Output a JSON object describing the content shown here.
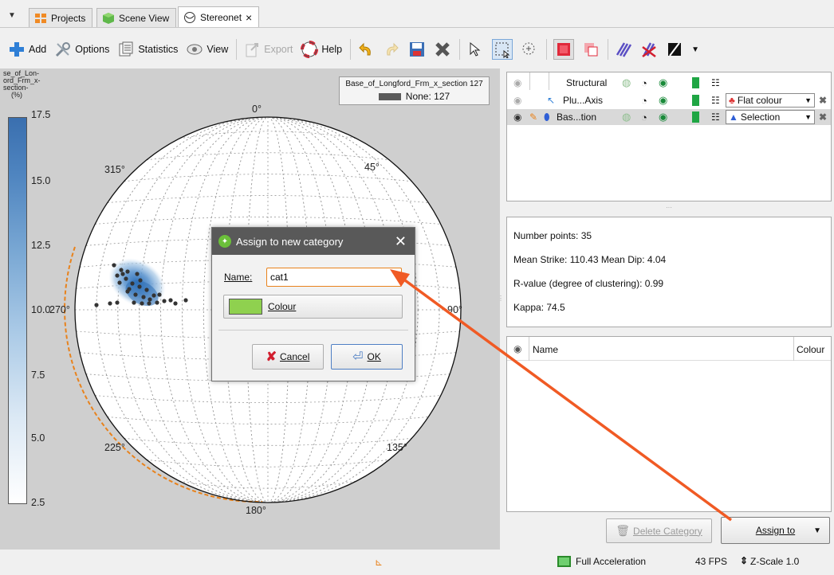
{
  "tabs": {
    "projects": "Projects",
    "scene_view": "Scene View",
    "stereonet": "Stereonet",
    "close_glyph": "×"
  },
  "toolbar": {
    "add": "Add",
    "options": "Options",
    "statistics": "Statistics",
    "view": "View",
    "export": "Export",
    "help": "Help"
  },
  "colorbar": {
    "title_lines": [
      "se_of_Lon-",
      "ord_Frm_x-",
      "section-",
      "(%)"
    ],
    "ticks": [
      "17.5",
      "15.0",
      "12.5",
      "10.0",
      "7.5",
      "5.0",
      "2.5"
    ]
  },
  "stereonet": {
    "labels": {
      "n": "0°",
      "ne": "45°",
      "e": "90°",
      "se": "135°",
      "s": "180°",
      "sw": "225°",
      "w": "270°",
      "nw": "315°"
    }
  },
  "legend": {
    "title": "Base_of_Longford_Frm_x_section 127",
    "entry": "None: 127",
    "swatch_color": "#5a5a5a"
  },
  "layers": {
    "header_label": "Structural",
    "rows": [
      {
        "name": "Plu...Axis",
        "mode": "Flat colour"
      },
      {
        "name": "Bas...tion",
        "mode": "Selection"
      }
    ]
  },
  "stats": {
    "number_points": "Number points: 35",
    "mean_strike_dip": "Mean Strike: 110.43  Mean Dip: 4.04",
    "r_value": "R-value (degree of clustering): 0.99",
    "kappa": "Kappa: 74.5"
  },
  "categories": {
    "col_name": "Name",
    "col_colour": "Colour"
  },
  "buttons": {
    "delete_category": "Delete Category",
    "assign_to": "Assign to"
  },
  "dialog": {
    "title": "Assign to new category",
    "name_label": "Name:",
    "name_value": "cat1",
    "colour_label": "Colour",
    "colour_swatch": "#8fd14f",
    "cancel": "Cancel",
    "ok": "OK"
  },
  "status": {
    "acceleration": "Full Acceleration",
    "fps": "43 FPS",
    "zscale": "Z-Scale 1.0"
  },
  "colors": {
    "arrow": "#f05a24",
    "orange_dash": "#e8821c",
    "point": "#333333"
  }
}
